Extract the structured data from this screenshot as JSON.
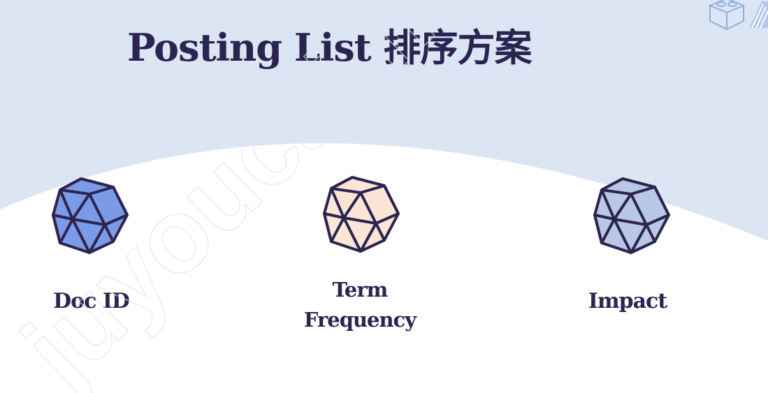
{
  "slide": {
    "title": "Posting List 排序方案",
    "watermark": "juyoucai.huxin"
  },
  "options": [
    {
      "id": "doc-id",
      "lines": [
        "Doc ID"
      ],
      "color": "#7b9be8"
    },
    {
      "id": "term-frequency",
      "lines": [
        "Term",
        "Frequency"
      ],
      "color": "#fbe6d6"
    },
    {
      "id": "impact",
      "lines": [
        "Impact"
      ],
      "color": "#b9c8e5"
    }
  ],
  "colors": {
    "background_top": "#dbe5f4",
    "background_arc": "#ffffff",
    "text": "#2c2450",
    "outline": "#2c2450"
  },
  "icons": [
    "icosahedron-icon",
    "logo-icon"
  ]
}
